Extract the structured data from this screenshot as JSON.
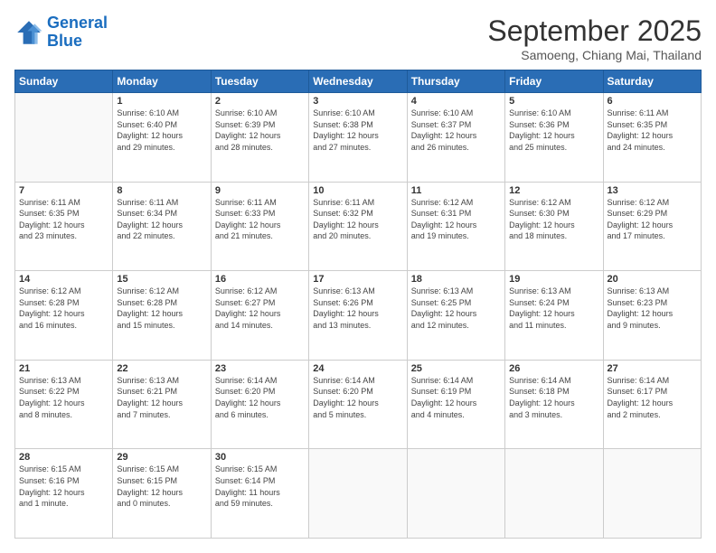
{
  "logo": {
    "line1": "General",
    "line2": "Blue"
  },
  "header": {
    "month": "September 2025",
    "location": "Samoeng, Chiang Mai, Thailand"
  },
  "weekdays": [
    "Sunday",
    "Monday",
    "Tuesday",
    "Wednesday",
    "Thursday",
    "Friday",
    "Saturday"
  ],
  "weeks": [
    [
      {
        "day": "",
        "info": ""
      },
      {
        "day": "1",
        "info": "Sunrise: 6:10 AM\nSunset: 6:40 PM\nDaylight: 12 hours\nand 29 minutes."
      },
      {
        "day": "2",
        "info": "Sunrise: 6:10 AM\nSunset: 6:39 PM\nDaylight: 12 hours\nand 28 minutes."
      },
      {
        "day": "3",
        "info": "Sunrise: 6:10 AM\nSunset: 6:38 PM\nDaylight: 12 hours\nand 27 minutes."
      },
      {
        "day": "4",
        "info": "Sunrise: 6:10 AM\nSunset: 6:37 PM\nDaylight: 12 hours\nand 26 minutes."
      },
      {
        "day": "5",
        "info": "Sunrise: 6:10 AM\nSunset: 6:36 PM\nDaylight: 12 hours\nand 25 minutes."
      },
      {
        "day": "6",
        "info": "Sunrise: 6:11 AM\nSunset: 6:35 PM\nDaylight: 12 hours\nand 24 minutes."
      }
    ],
    [
      {
        "day": "7",
        "info": "Sunrise: 6:11 AM\nSunset: 6:35 PM\nDaylight: 12 hours\nand 23 minutes."
      },
      {
        "day": "8",
        "info": "Sunrise: 6:11 AM\nSunset: 6:34 PM\nDaylight: 12 hours\nand 22 minutes."
      },
      {
        "day": "9",
        "info": "Sunrise: 6:11 AM\nSunset: 6:33 PM\nDaylight: 12 hours\nand 21 minutes."
      },
      {
        "day": "10",
        "info": "Sunrise: 6:11 AM\nSunset: 6:32 PM\nDaylight: 12 hours\nand 20 minutes."
      },
      {
        "day": "11",
        "info": "Sunrise: 6:12 AM\nSunset: 6:31 PM\nDaylight: 12 hours\nand 19 minutes."
      },
      {
        "day": "12",
        "info": "Sunrise: 6:12 AM\nSunset: 6:30 PM\nDaylight: 12 hours\nand 18 minutes."
      },
      {
        "day": "13",
        "info": "Sunrise: 6:12 AM\nSunset: 6:29 PM\nDaylight: 12 hours\nand 17 minutes."
      }
    ],
    [
      {
        "day": "14",
        "info": "Sunrise: 6:12 AM\nSunset: 6:28 PM\nDaylight: 12 hours\nand 16 minutes."
      },
      {
        "day": "15",
        "info": "Sunrise: 6:12 AM\nSunset: 6:28 PM\nDaylight: 12 hours\nand 15 minutes."
      },
      {
        "day": "16",
        "info": "Sunrise: 6:12 AM\nSunset: 6:27 PM\nDaylight: 12 hours\nand 14 minutes."
      },
      {
        "day": "17",
        "info": "Sunrise: 6:13 AM\nSunset: 6:26 PM\nDaylight: 12 hours\nand 13 minutes."
      },
      {
        "day": "18",
        "info": "Sunrise: 6:13 AM\nSunset: 6:25 PM\nDaylight: 12 hours\nand 12 minutes."
      },
      {
        "day": "19",
        "info": "Sunrise: 6:13 AM\nSunset: 6:24 PM\nDaylight: 12 hours\nand 11 minutes."
      },
      {
        "day": "20",
        "info": "Sunrise: 6:13 AM\nSunset: 6:23 PM\nDaylight: 12 hours\nand 9 minutes."
      }
    ],
    [
      {
        "day": "21",
        "info": "Sunrise: 6:13 AM\nSunset: 6:22 PM\nDaylight: 12 hours\nand 8 minutes."
      },
      {
        "day": "22",
        "info": "Sunrise: 6:13 AM\nSunset: 6:21 PM\nDaylight: 12 hours\nand 7 minutes."
      },
      {
        "day": "23",
        "info": "Sunrise: 6:14 AM\nSunset: 6:20 PM\nDaylight: 12 hours\nand 6 minutes."
      },
      {
        "day": "24",
        "info": "Sunrise: 6:14 AM\nSunset: 6:20 PM\nDaylight: 12 hours\nand 5 minutes."
      },
      {
        "day": "25",
        "info": "Sunrise: 6:14 AM\nSunset: 6:19 PM\nDaylight: 12 hours\nand 4 minutes."
      },
      {
        "day": "26",
        "info": "Sunrise: 6:14 AM\nSunset: 6:18 PM\nDaylight: 12 hours\nand 3 minutes."
      },
      {
        "day": "27",
        "info": "Sunrise: 6:14 AM\nSunset: 6:17 PM\nDaylight: 12 hours\nand 2 minutes."
      }
    ],
    [
      {
        "day": "28",
        "info": "Sunrise: 6:15 AM\nSunset: 6:16 PM\nDaylight: 12 hours\nand 1 minute."
      },
      {
        "day": "29",
        "info": "Sunrise: 6:15 AM\nSunset: 6:15 PM\nDaylight: 12 hours\nand 0 minutes."
      },
      {
        "day": "30",
        "info": "Sunrise: 6:15 AM\nSunset: 6:14 PM\nDaylight: 11 hours\nand 59 minutes."
      },
      {
        "day": "",
        "info": ""
      },
      {
        "day": "",
        "info": ""
      },
      {
        "day": "",
        "info": ""
      },
      {
        "day": "",
        "info": ""
      }
    ]
  ]
}
